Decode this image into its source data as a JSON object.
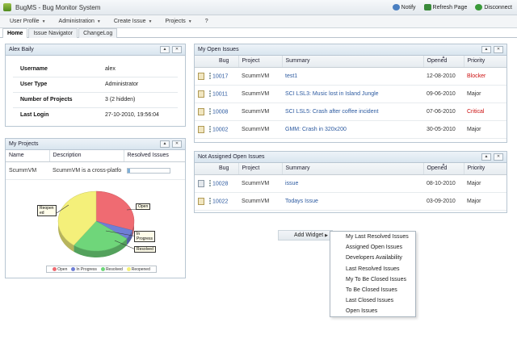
{
  "app": {
    "title": "BugMS - Bug Monitor System"
  },
  "top_actions": [
    {
      "label": "Notify",
      "icon": "notify-icon",
      "color": "#4a7fc1"
    },
    {
      "label": "Refresh Page",
      "icon": "refresh-icon",
      "color": "#3a8a3a"
    },
    {
      "label": "Disconnect",
      "icon": "disconnect-icon",
      "color": "#3a9a3a"
    }
  ],
  "menu": [
    "User Profile",
    "Administration",
    "Create Issue",
    "Projects",
    "?"
  ],
  "tabs": [
    "Home",
    "Issue Navigator",
    "ChangeLog"
  ],
  "user_widget": {
    "title": "Alex Baily",
    "rows": [
      {
        "key": "Username",
        "value": "alex"
      },
      {
        "key": "User Type",
        "value": "Administrator"
      },
      {
        "key": "Number of Projects",
        "value": "3 (2 hidden)"
      },
      {
        "key": "Last Login",
        "value": "27-10-2010, 19:56:04"
      }
    ]
  },
  "projects_widget": {
    "title": "My Projects",
    "columns": [
      "Name",
      "Description",
      "Resolved Issues"
    ],
    "rows": [
      {
        "name": "ScummVM",
        "description": "ScummVM is a cross-platfo",
        "resolved_fraction": 0.05
      }
    ]
  },
  "open_issues_widget": {
    "title": "My Open Issues",
    "columns": [
      "Bug",
      "Project",
      "Summary",
      "Opened",
      "Priority"
    ],
    "rows": [
      {
        "bug": "10017",
        "project": "ScummVM",
        "summary": "test1",
        "opened": "12-08-2010",
        "priority": "Blocker",
        "priority_color": "#cc1111"
      },
      {
        "bug": "10011",
        "project": "ScummVM",
        "summary": "SCI LSL3: Music lost in Island Jungle",
        "opened": "09-06-2010",
        "priority": "Major",
        "priority_color": "#333333"
      },
      {
        "bug": "10008",
        "project": "ScummVM",
        "summary": "SCI LSL5: Crash after coffee incident",
        "opened": "07-06-2010",
        "priority": "Critical",
        "priority_color": "#cc1111"
      },
      {
        "bug": "10002",
        "project": "ScummVM",
        "summary": "GMM: Crash in 320x200",
        "opened": "30-05-2010",
        "priority": "Major",
        "priority_color": "#333333"
      }
    ]
  },
  "unassigned_widget": {
    "title": "Not Assigned Open Issues",
    "columns": [
      "Bug",
      "Project",
      "Summary",
      "Opened",
      "Priority"
    ],
    "rows": [
      {
        "bug": "10028",
        "project": "ScummVM",
        "summary": "issue",
        "opened": "08-10-2010",
        "priority": "Major"
      },
      {
        "bug": "10022",
        "project": "ScummVM",
        "summary": "Todays Issue",
        "opened": "03-09-2010",
        "priority": "Major"
      }
    ]
  },
  "add_widget": {
    "label": "Add Widget",
    "options": [
      "My Last Resolved Issues",
      "Assigned Open Issues",
      "Developers Availability",
      "Last Resolved Issues",
      "My To Be Closed Issues",
      "To Be Closed Issues",
      "Last Closed Issues",
      "Open Issues"
    ]
  },
  "chart_data": {
    "type": "pie",
    "slices": [
      {
        "label": "Open",
        "value": 30,
        "color": "#ef6b72"
      },
      {
        "label": "In Progress",
        "value": 5,
        "color": "#6f7fd6"
      },
      {
        "label": "Resolved",
        "value": 25,
        "color": "#6fd67a"
      },
      {
        "label": "Reopened",
        "value": 40,
        "color": "#f4f07a"
      }
    ],
    "callouts": [
      {
        "text": "Open",
        "slice": "Open"
      },
      {
        "text": "In Progress",
        "slice": "In Progress"
      },
      {
        "text": "Resolved",
        "slice": "Resolved"
      },
      {
        "text": "Reopened",
        "slice": "Reopened"
      }
    ],
    "legend": [
      "Open",
      "In Progress",
      "Resolved",
      "Reopened"
    ]
  }
}
